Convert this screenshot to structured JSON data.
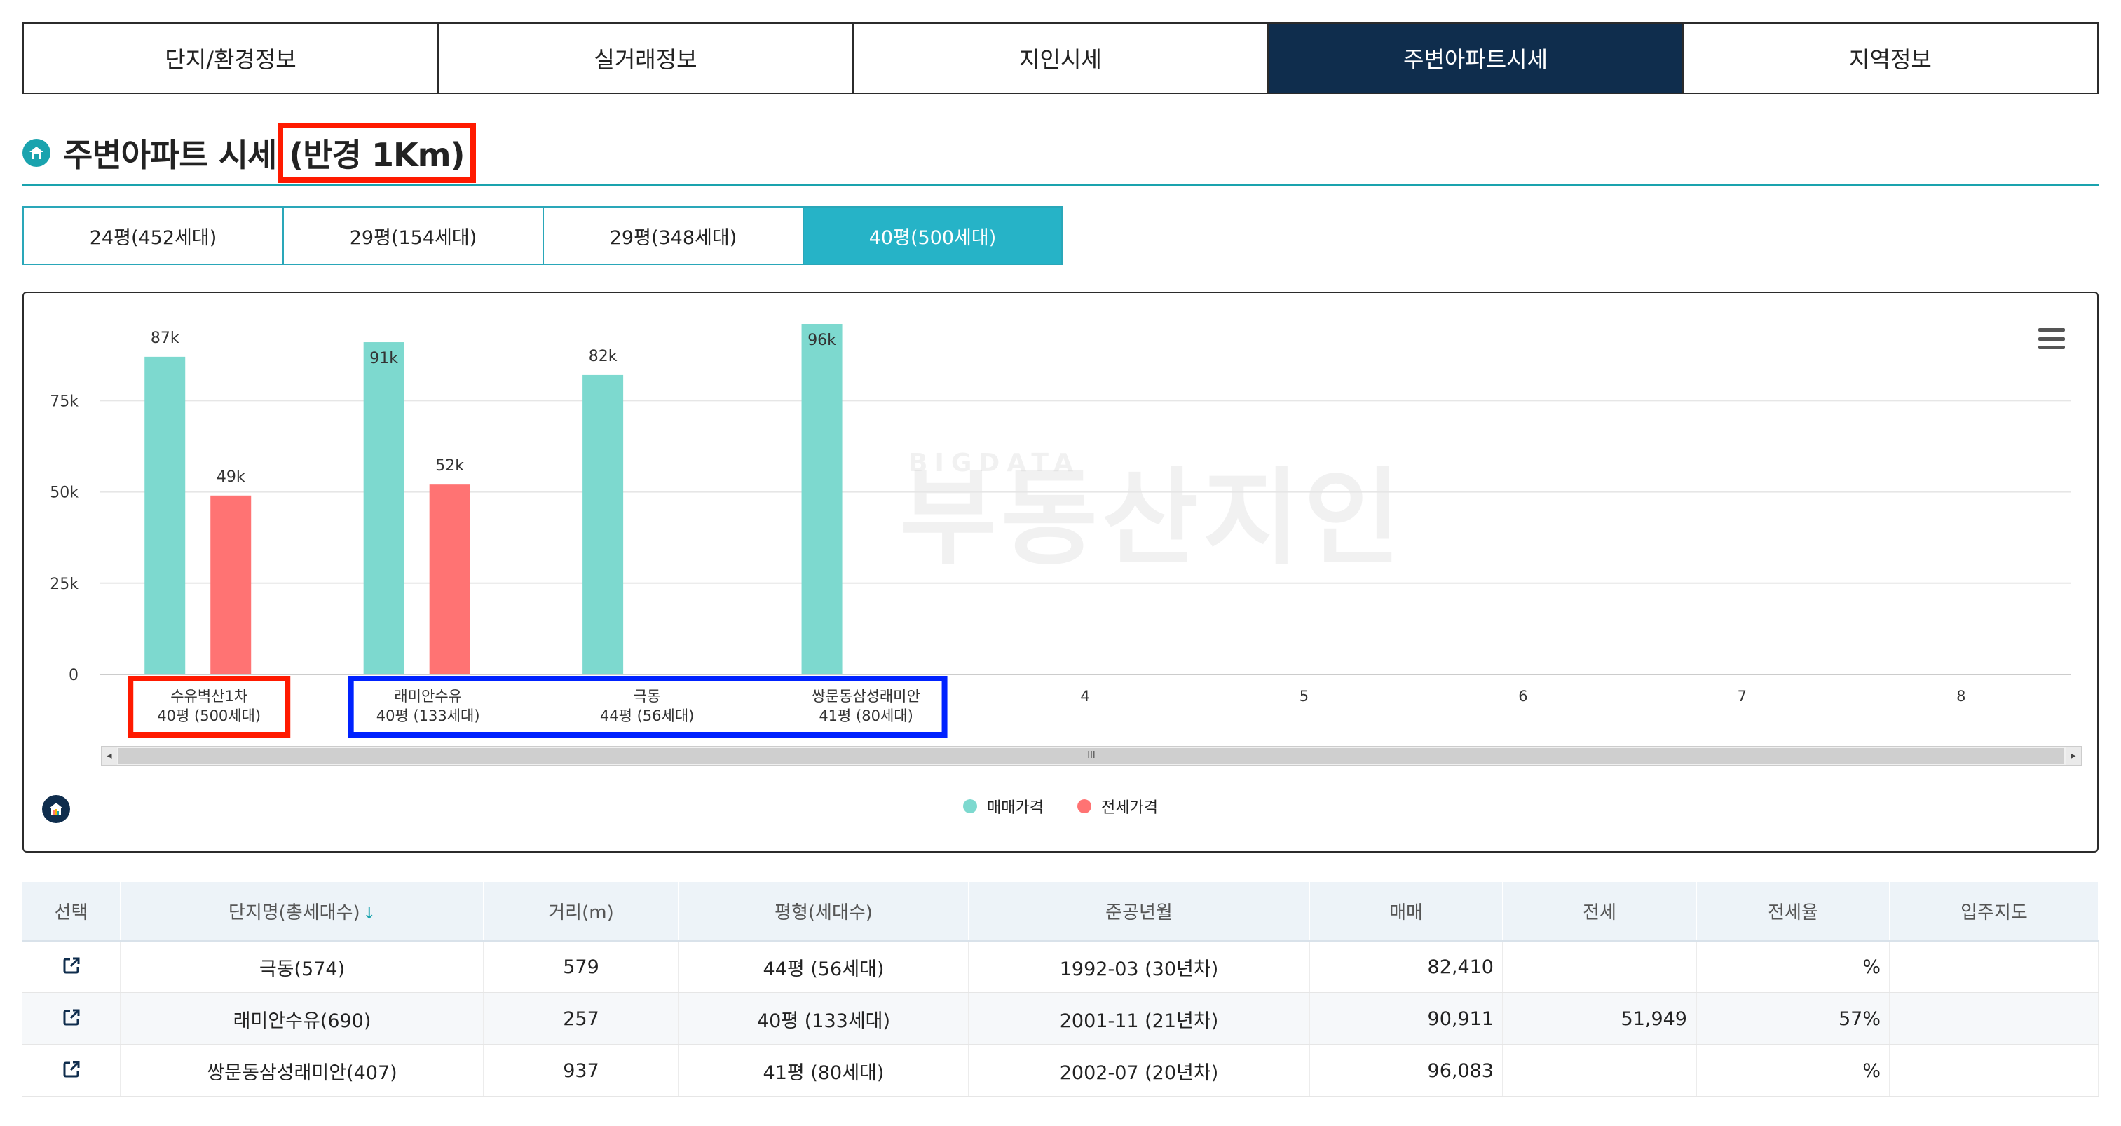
{
  "main_tabs": [
    {
      "label": "단지/환경정보",
      "active": false
    },
    {
      "label": "실거래정보",
      "active": false
    },
    {
      "label": "지인시세",
      "active": false
    },
    {
      "label": "주변아파트시세",
      "active": true
    },
    {
      "label": "지역정보",
      "active": false
    }
  ],
  "section": {
    "title": "주변아파트 시세",
    "radius": "(반경 1Km)"
  },
  "sub_tabs": [
    {
      "label": "24평(452세대)",
      "active": false
    },
    {
      "label": "29평(154세대)",
      "active": false
    },
    {
      "label": "29평(348세대)",
      "active": false
    },
    {
      "label": "40평(500세대)",
      "active": true
    }
  ],
  "watermark": {
    "top": "BIGDATA",
    "main": "부동산지인"
  },
  "colors": {
    "accent": "#1aa3ae",
    "navy": "#0f2d4d",
    "sale": "#7dd9cf",
    "jeonse": "#ff7373",
    "highlight_red": "#ff1a00",
    "highlight_blue": "#0022ff"
  },
  "chart_data": {
    "type": "bar",
    "categories": [
      [
        "수유벽산1차",
        "40평 (500세대)"
      ],
      [
        "래미안수유",
        "40평 (133세대)"
      ],
      [
        "극동",
        "44평 (56세대)"
      ],
      [
        "쌍문동삼성래미안",
        "41평 (80세대)"
      ],
      [
        "4"
      ],
      [
        "5"
      ],
      [
        "6"
      ],
      [
        "7"
      ],
      [
        "8"
      ]
    ],
    "series": [
      {
        "name": "매매가격",
        "values": [
          87,
          91,
          82,
          96,
          null,
          null,
          null,
          null,
          null
        ],
        "labels": [
          "87k",
          "91k",
          "82k",
          "96k"
        ]
      },
      {
        "name": "전세가격",
        "values": [
          49,
          52,
          null,
          null,
          null,
          null,
          null,
          null,
          null
        ],
        "labels": [
          "49k",
          "52k"
        ]
      }
    ],
    "ylim": [
      0,
      96
    ],
    "yticks": [
      0,
      25,
      50,
      75
    ],
    "ytick_labels": [
      "0",
      "25k",
      "50k",
      "75k"
    ],
    "grid": true,
    "legend": "bottom-center"
  },
  "scrollbar": {
    "grip": "III",
    "left": "◂",
    "right": "▸"
  },
  "table": {
    "headers": [
      "선택",
      "단지명(총세대수)",
      "거리(m)",
      "평형(세대수)",
      "준공년월",
      "매매",
      "전세",
      "전세율",
      "입주지도"
    ],
    "sort_arrow": "↓",
    "rows": [
      {
        "name": "극동(574)",
        "distance": "579",
        "size": "44평 (56세대)",
        "built": "1992-03 (30년차)",
        "sale": "82,410",
        "jeonse": "",
        "ratio": "%",
        "map": ""
      },
      {
        "name": "래미안수유(690)",
        "distance": "257",
        "size": "40평 (133세대)",
        "built": "2001-11 (21년차)",
        "sale": "90,911",
        "jeonse": "51,949",
        "ratio": "57%",
        "map": ""
      },
      {
        "name": "쌍문동삼성래미안(407)",
        "distance": "937",
        "size": "41평 (80세대)",
        "built": "2002-07 (20년차)",
        "sale": "96,083",
        "jeonse": "",
        "ratio": "%",
        "map": ""
      }
    ]
  }
}
